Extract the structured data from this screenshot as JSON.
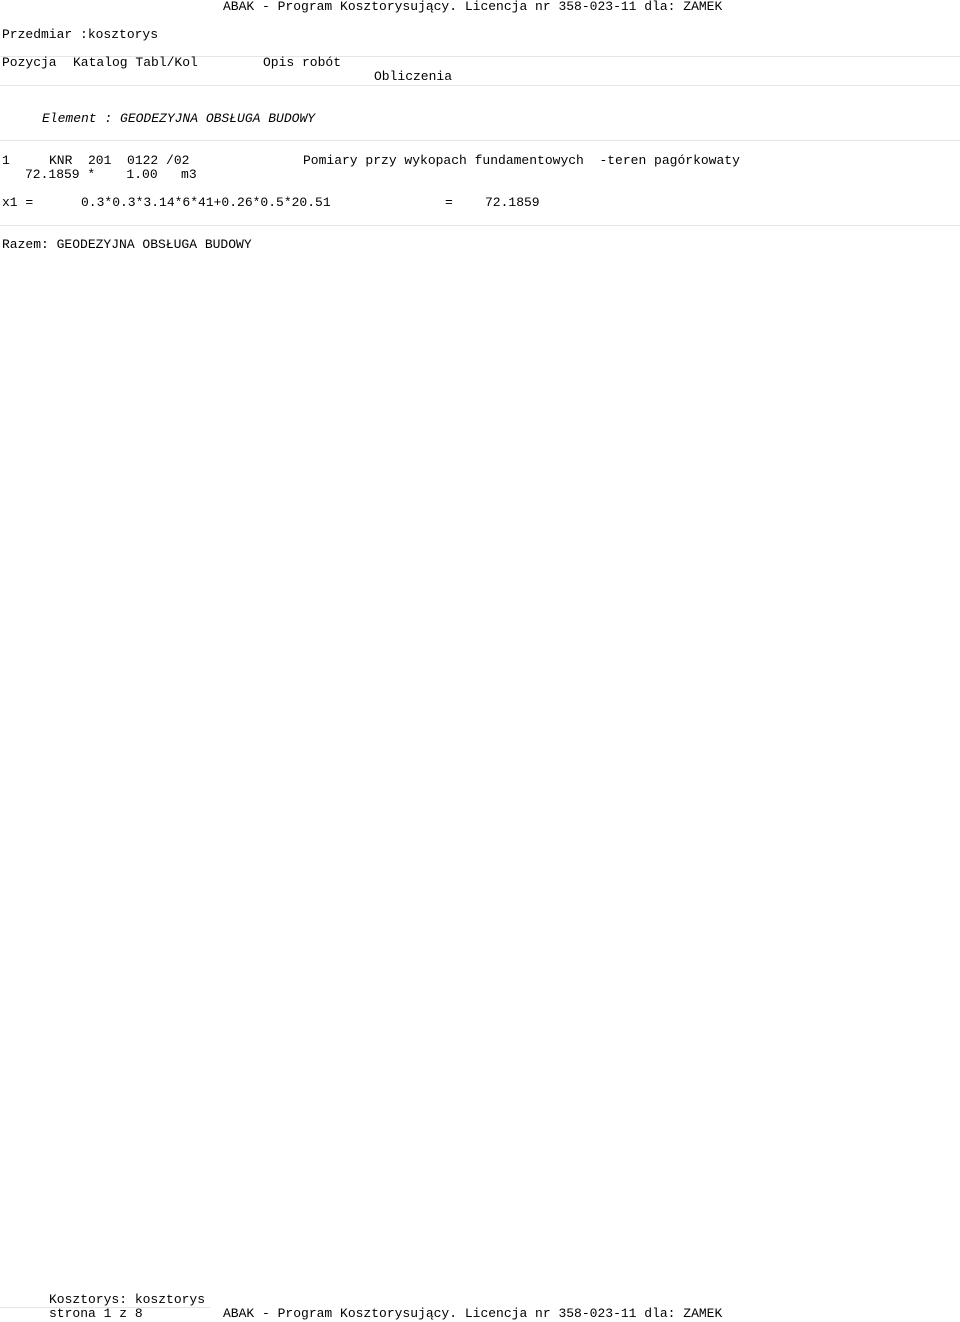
{
  "header": {
    "program_line": "ABAK - Program Kosztorysujący. Licencja nr 358-023-11 dla: ZAMEK",
    "przedmiar_label": "Przedmiar :kosztorys"
  },
  "columns": {
    "pozycja": "Pozycja",
    "katalog": "Katalog Tabl/Kol",
    "opis": "Opis robót",
    "obliczenia": "Obliczenia"
  },
  "element": {
    "label": "Element : GEODEZYJNA OBSŁUGA BUDOWY"
  },
  "items": [
    {
      "pozycja": "1",
      "katalog": "KNR  201  0122 /02",
      "opis": "Pomiary przy wykopach fundamentowych  -teren pagórkowaty",
      "ilosc_line": "72.1859 *    1.00   m3",
      "obliczenie": {
        "var": "x1 =",
        "expr": "0.3*0.3*3.14*6*41+0.26*0.5*20.51",
        "eq": "=",
        "result": "72.1859"
      }
    }
  ],
  "razem": "Razem: GEODEZYJNA OBSŁUGA BUDOWY",
  "footer": {
    "kosztorys_label": "Kosztorys: kosztorys",
    "page_label": "strona 1 z 8",
    "program_line": "ABAK - Program Kosztorysujący. Licencja nr 358-023-11 dla: ZAMEK"
  }
}
